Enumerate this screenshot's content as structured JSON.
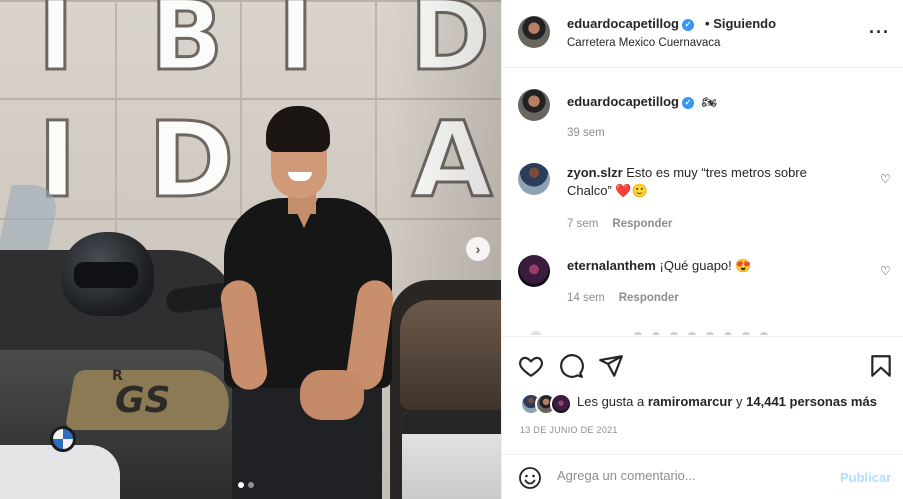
{
  "post": {
    "owner": "eduardocapetillog",
    "follow_separator": "•",
    "follow_status": "Siguiendo",
    "location": "Carretera Mexico Cuernavaca",
    "caption_emoji": "🏍",
    "caption_age": "39 sem",
    "more_icon": "more-horizontal-icon",
    "next_icon": "chevron-right-icon",
    "photo_wall_letters": [
      "I",
      "B",
      "I",
      "D",
      "I",
      "D",
      "A"
    ],
    "photo_bike_badge": "R",
    "photo_bike_text": "GS",
    "carousel_dots": 2,
    "carousel_active": 0
  },
  "comments": [
    {
      "user": "zyon.slzr",
      "text_line1": "Esto es muy “tres metros sobre",
      "text_line2": "Chalco”",
      "emojis": "❤️🙂",
      "age": "7 sem",
      "reply": "Responder"
    },
    {
      "user": "eternalanthem",
      "text": "¡Qué guapo!",
      "emojis": "😍",
      "age": "14 sem",
      "reply": "Responder"
    }
  ],
  "actions": {
    "icons": [
      "heart-icon",
      "comment-icon",
      "share-icon",
      "bookmark-icon"
    ],
    "likes_prefix": "Les gusta a",
    "likes_user": "ramiromarcur",
    "likes_and": "y",
    "likes_count": "14,441 personas más",
    "date": "13 DE JUNIO DE 2021"
  },
  "composer": {
    "placeholder": "Agrega un comentario...",
    "publish": "Publicar"
  },
  "colors": {
    "verified": "#3897f0",
    "publish_disabled": "#b2dffc",
    "text": "#262626",
    "muted": "#8e8e8e"
  }
}
